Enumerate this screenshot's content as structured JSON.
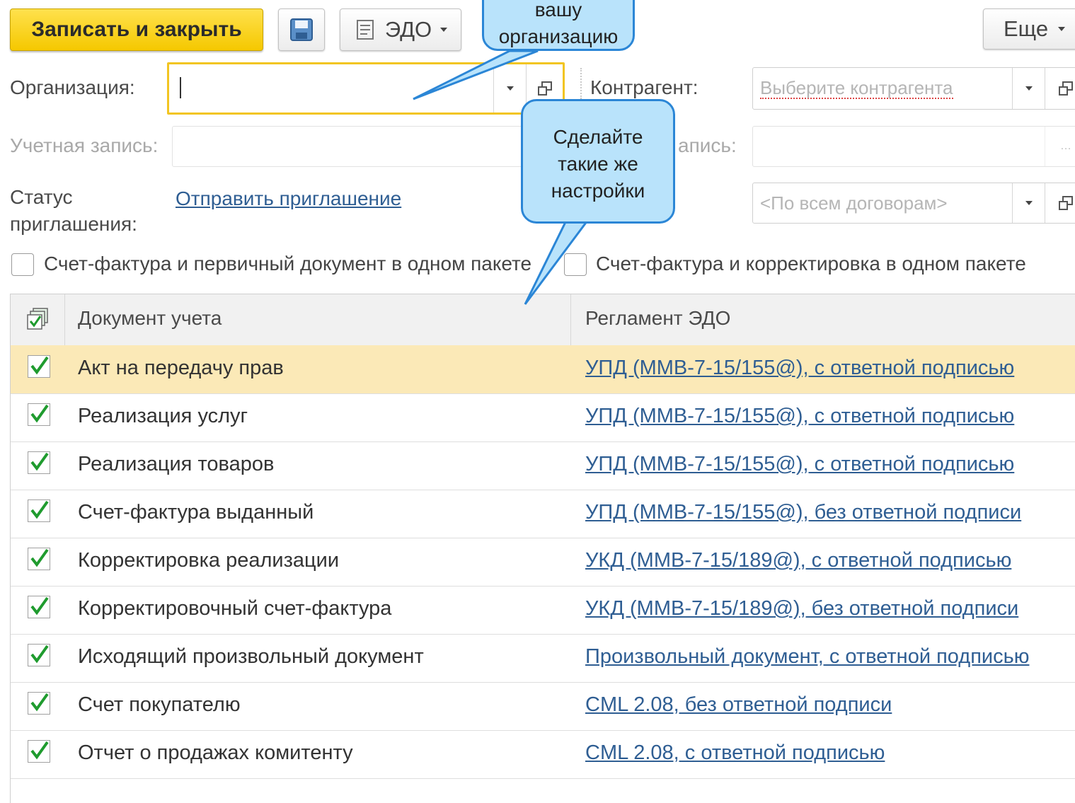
{
  "toolbar": {
    "save_close_label": "Записать и закрыть",
    "save_icon": "floppy-disk-icon",
    "edo_icon": "document-list-icon",
    "edo_label": "ЭДО",
    "more_label": "Еще"
  },
  "form": {
    "organization_label": "Организация:",
    "organization_value": "",
    "counterparty_label": "Контрагент:",
    "counterparty_placeholder": "Выберите контрагента",
    "account_label": "Учетная запись:",
    "account_right_label_partial": "апись:",
    "invite_status_label_line1": "Статус",
    "invite_status_label_line2": "приглашения:",
    "invite_link": "Отправить приглашение",
    "contract_placeholder": "<По всем договорам>",
    "check_package_primary": "Счет-фактура и первичный документ в одном пакете",
    "check_package_correction": "Счет-фактура и корректировка в одном пакете"
  },
  "callouts": {
    "top_line1": "вашу",
    "top_line2": "организацию",
    "mid_line1": "Сделайте",
    "mid_line2": "такие же",
    "mid_line3": "настройки"
  },
  "table": {
    "columns": [
      "Документ учета",
      "Регламент ЭДО"
    ],
    "rows": [
      {
        "doc": "Акт на передачу прав",
        "reg": "УПД (ММВ-7-15/155@), с ответной подписью",
        "checked": true,
        "selected": true
      },
      {
        "doc": "Реализация услуг",
        "reg": "УПД (ММВ-7-15/155@), с ответной подписью",
        "checked": true,
        "selected": false
      },
      {
        "doc": "Реализация товаров",
        "reg": "УПД (ММВ-7-15/155@), с ответной подписью",
        "checked": true,
        "selected": false
      },
      {
        "doc": "Счет-фактура выданный",
        "reg": "УПД (ММВ-7-15/155@), без ответной подписи",
        "checked": true,
        "selected": false
      },
      {
        "doc": "Корректировка реализации",
        "reg": "УКД (ММВ-7-15/189@), с ответной подписью",
        "checked": true,
        "selected": false
      },
      {
        "doc": "Корректировочный счет-фактура",
        "reg": "УКД (ММВ-7-15/189@), без ответной подписи",
        "checked": true,
        "selected": false
      },
      {
        "doc": "Исходящий произвольный документ",
        "reg": "Произвольный документ, с ответной подписью",
        "checked": true,
        "selected": false
      },
      {
        "doc": "Счет покупателю",
        "reg": "CML 2.08, без ответной подписи",
        "checked": true,
        "selected": false
      },
      {
        "doc": "Отчет о продажах комитенту",
        "reg": "CML 2.08, с ответной подписью",
        "checked": true,
        "selected": false
      }
    ]
  },
  "colors": {
    "primary_button": "#f5c800",
    "selected_row": "#fbe9b7",
    "link": "#2f5e93",
    "check_green": "#1f9b2e",
    "callout_fill": "#b9e3fb",
    "callout_border": "#2b86d6"
  }
}
